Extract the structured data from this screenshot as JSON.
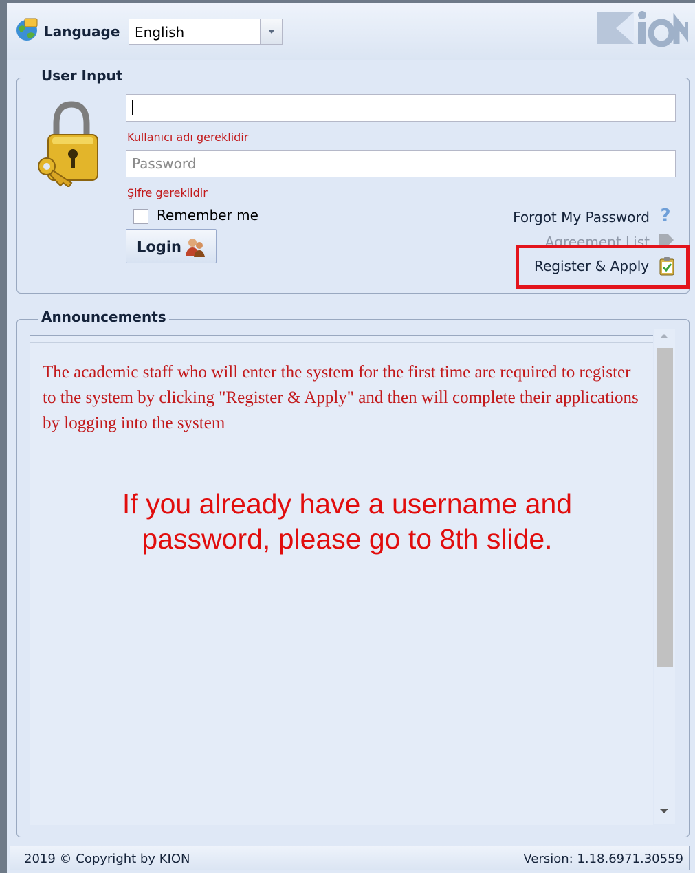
{
  "topbar": {
    "language_label": "Language",
    "language_value": "English",
    "logo_text": "KION"
  },
  "user_input": {
    "legend": "User Input",
    "username_value": "",
    "username_error": "Kullanıcı adı gereklidir",
    "password_placeholder": "Password",
    "password_error": "Şifre gereklidir",
    "remember_label": "Remember me",
    "login_label": "Login",
    "forgot_label": "Forgot My Password",
    "agreement_label": "Agreement List",
    "register_label": "Register & Apply"
  },
  "announcements": {
    "legend": "Announcements",
    "text": "The academic staff who will enter the system for the first time are required to register to the system by clicking \"Register & Apply\" and then will complete their applications by logging into the system",
    "overlay_note": "If you already have a username and password, please go to 8th slide."
  },
  "footer": {
    "copyright": "2019 © Copyright by KION",
    "version": "Version: 1.18.6971.30559"
  },
  "colors": {
    "error_red": "#c2191b",
    "highlight_red": "#e3141c",
    "panel_bg": "#dfe8f6"
  }
}
